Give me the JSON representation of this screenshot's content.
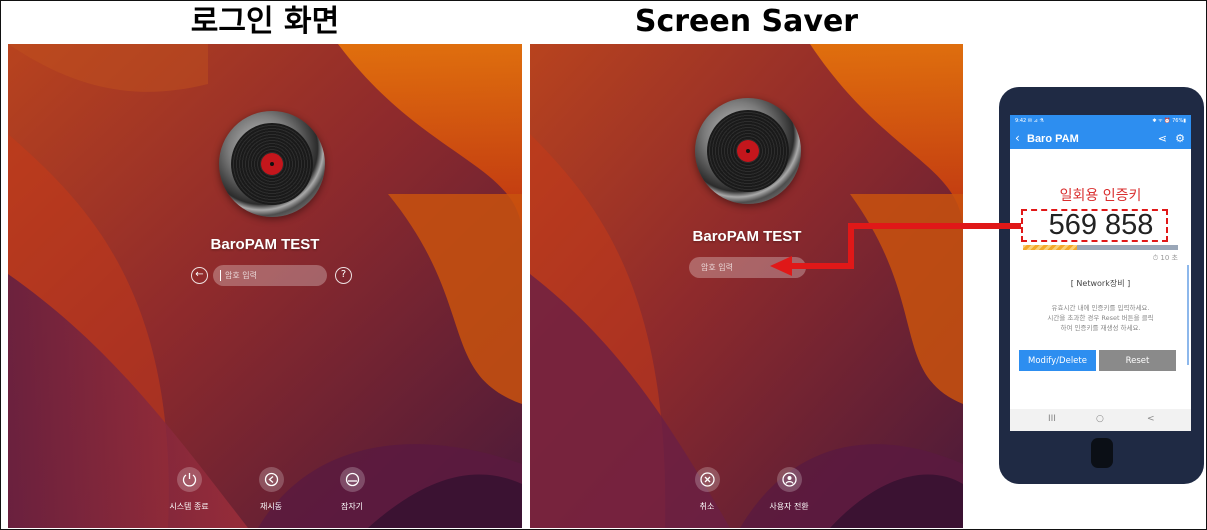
{
  "titles": {
    "login": "로그인 화면",
    "saver": "Screen Saver"
  },
  "login_screen": {
    "user_name": "BaroPAM TEST",
    "password_placeholder": "암호 입력",
    "back_icon": "arrow-left-circle-icon",
    "help_icon": "question-circle-icon",
    "actions": [
      {
        "label": "시스템 종료",
        "icon": "power-icon"
      },
      {
        "label": "재시동",
        "icon": "restart-icon"
      },
      {
        "label": "잠자기",
        "icon": "sleep-icon"
      }
    ]
  },
  "saver_screen": {
    "user_name": "BaroPAM TEST",
    "password_placeholder": "암호 입력",
    "actions": [
      {
        "label": "취소",
        "icon": "cancel-icon"
      },
      {
        "label": "사용자 전환",
        "icon": "switch-user-icon"
      }
    ]
  },
  "phone": {
    "status_left": "9:42 ✉ ⊿ ⚗",
    "status_right": "✱ ᯤ ⏰ 76%▮",
    "app_title": "Baro PAM",
    "otp_title": "일회용 인증키",
    "otp_code": "569 858",
    "otp_progress": 0.35,
    "timer": "⏱ 10 초",
    "network_label": "[ Network장비 ]",
    "notice_lines": [
      "유효시간 내에 인증키를 입력하세요.",
      "시간을 초과한 경우 Reset 버튼을 클릭",
      "하여 인증키를 재생성 하세요."
    ],
    "modify_button": "Modify/Delete",
    "reset_button": "Reset",
    "nav": [
      "III",
      "○",
      "<"
    ]
  },
  "colors": {
    "accent_blue": "#2d8ef0",
    "annotation_red": "#e01818",
    "otp_title_red": "#d92e2e"
  }
}
